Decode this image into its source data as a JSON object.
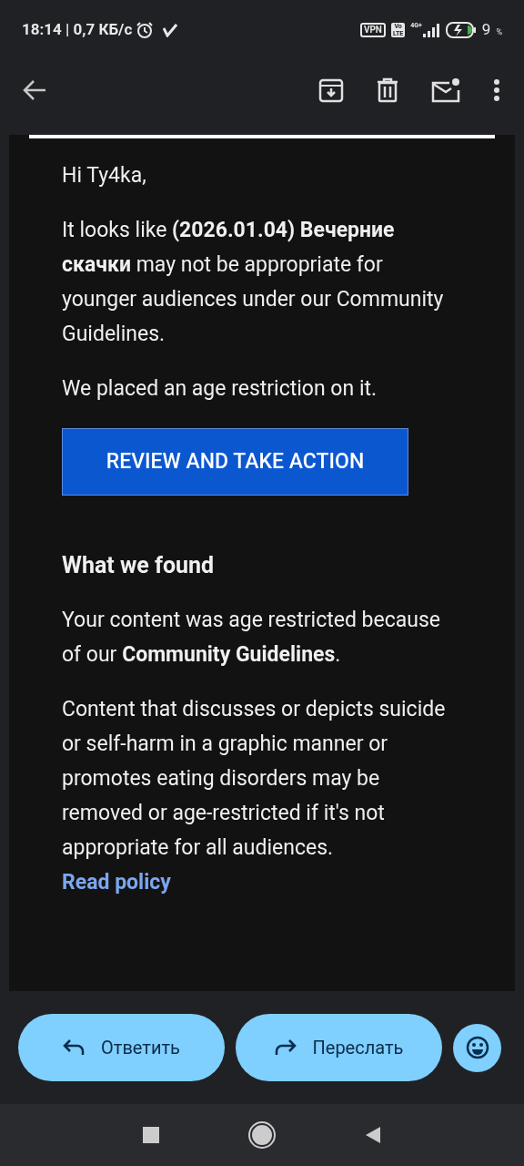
{
  "status_bar": {
    "time": "18:14 | 0,7 КБ/с",
    "vpn": "VPN",
    "volte_top": "Vo",
    "volte_bottom": "LTE",
    "network": "4G+",
    "battery": "9",
    "percent": "%"
  },
  "email": {
    "greeting": "Hi Ty4ka,",
    "paragraphs": [
      "It looks like **(2026.01.04) Вечерние скачки** may not be appropriate for younger audiences under our Community Guidelines.",
      "We placed an age restriction on it."
    ],
    "action_button": "REVIEW AND TAKE ACTION",
    "heading": "What we found",
    "found_paragraphs": [
      "Your content was age restricted because of our **Community Guidelines**.",
      "Content that discusses or depicts suicide or self-harm in a graphic manner or promotes eating disorders may be removed or age-restricted if it's not appropriate for all audiences."
    ],
    "link": "Read policy"
  },
  "actions": {
    "reply": "Ответить",
    "forward": "Переслать"
  }
}
